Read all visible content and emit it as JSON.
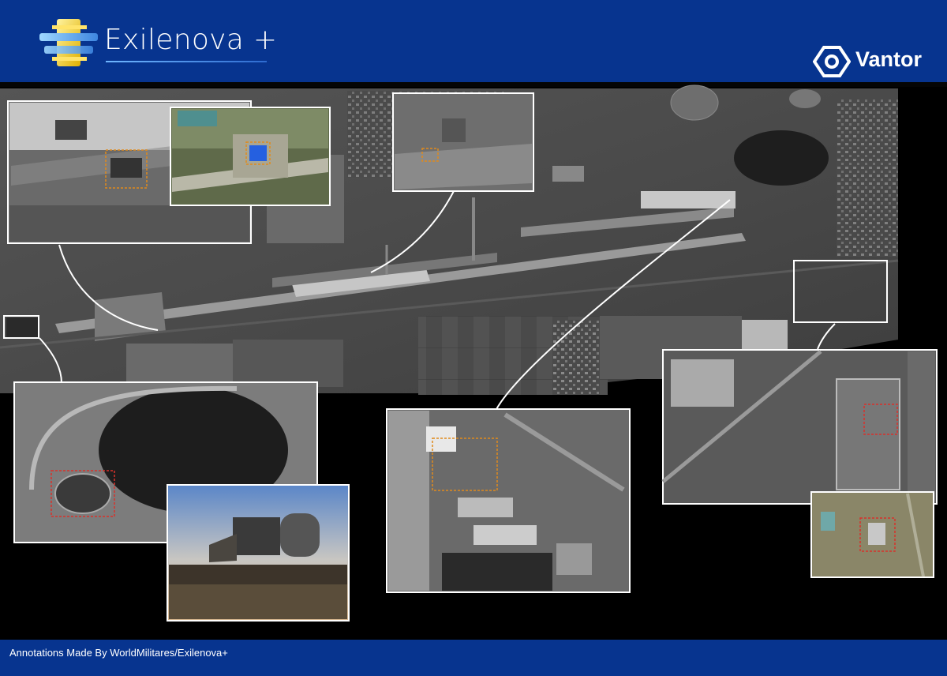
{
  "header": {
    "brand": "Exilenova +",
    "logo_icon": "exilenova-logo-icon",
    "partner": "Vantor",
    "partner_icon": "vantor-logo-icon"
  },
  "footer": {
    "credit": "Annotations Made By WorldMilitares/Exilenova+"
  },
  "colors": {
    "header_bg": "#07348f",
    "annotation_orange": "#e08a1c",
    "annotation_red": "#d8312b",
    "annotation_blue": "#2560e0",
    "frame_white": "#ffffff"
  }
}
